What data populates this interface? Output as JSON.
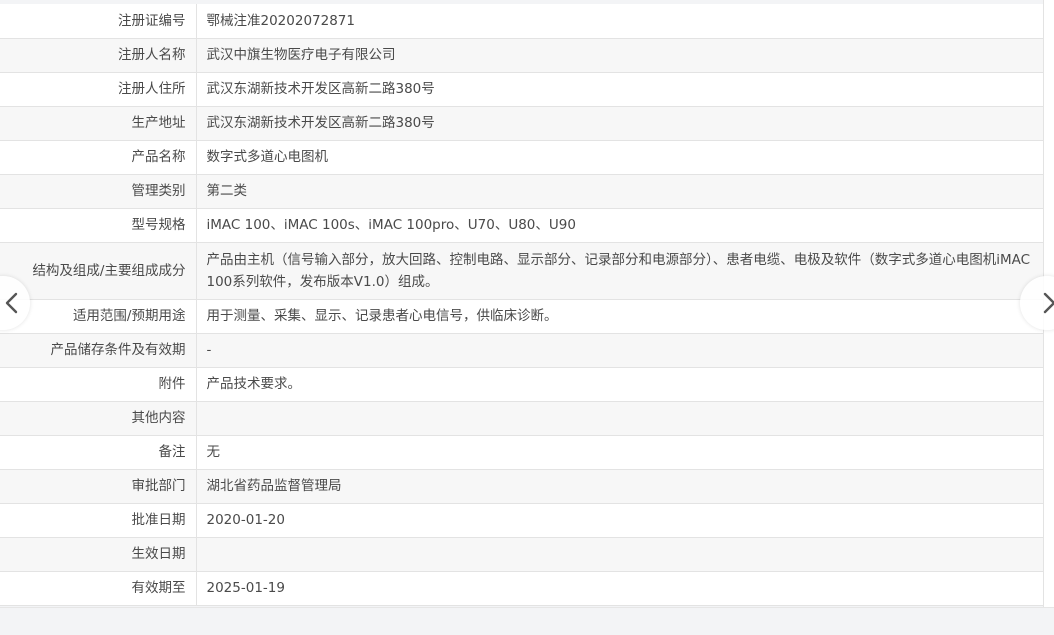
{
  "rows": [
    {
      "label": "注册证编号",
      "value": "鄂械注准20202072871"
    },
    {
      "label": "注册人名称",
      "value": "武汉中旗生物医疗电子有限公司"
    },
    {
      "label": "注册人住所",
      "value": "武汉东湖新技术开发区高新二路380号"
    },
    {
      "label": "生产地址",
      "value": "武汉东湖新技术开发区高新二路380号"
    },
    {
      "label": "产品名称",
      "value": "数字式多道心电图机"
    },
    {
      "label": "管理类别",
      "value": "第二类"
    },
    {
      "label": "型号规格",
      "value": "iMAC 100、iMAC 100s、iMAC 100pro、U70、U80、U90"
    },
    {
      "label": "结构及组成/主要组成成分",
      "value": "产品由主机（信号输入部分，放大回路、控制电路、显示部分、记录部分和电源部分）、患者电缆、电极及软件（数字式多道心电图机iMAC 100系列软件，发布版本V1.0）组成。"
    },
    {
      "label": "适用范围/预期用途",
      "value": "用于测量、采集、显示、记录患者心电信号，供临床诊断。"
    },
    {
      "label": "产品储存条件及有效期",
      "value": "-"
    },
    {
      "label": "附件",
      "value": "产品技术要求。"
    },
    {
      "label": "其他内容",
      "value": ""
    },
    {
      "label": "备注",
      "value": "无"
    },
    {
      "label": "审批部门",
      "value": "湖北省药品监督管理局"
    },
    {
      "label": "批准日期",
      "value": "2020-01-20"
    },
    {
      "label": "生效日期",
      "value": ""
    },
    {
      "label": "有效期至",
      "value": "2025-01-19"
    }
  ],
  "navigation": {
    "prev_icon": "chevron-left-icon",
    "next_icon": "chevron-right-icon"
  },
  "colors": {
    "border": "#e3e3e3",
    "row_alt": "#f7f7f7",
    "text": "#4a4a4a",
    "background": "#f3f4f6"
  }
}
